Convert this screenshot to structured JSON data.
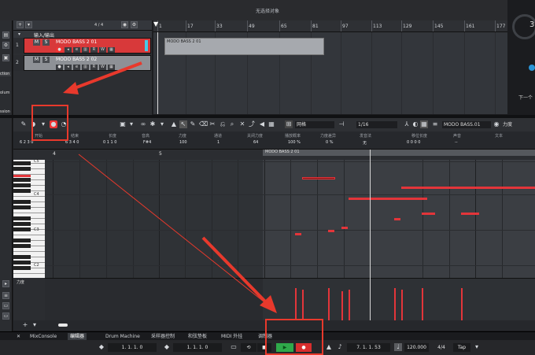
{
  "window": {
    "title": "无选择对象"
  },
  "left_strip": {
    "labels": [
      "ction",
      "olum",
      "ssion"
    ]
  },
  "track_list": {
    "counter": "4 / 4",
    "folder": {
      "label": "输入/输出"
    },
    "tracks": [
      {
        "number": "1",
        "name": "MODO BASS 2 01",
        "mute": "M",
        "solo": "S",
        "read": "R",
        "write": "W"
      },
      {
        "number": "2",
        "name": "MODO BASS 2 02",
        "mute": "M",
        "solo": "S",
        "read": "R",
        "write": "W"
      }
    ]
  },
  "project_ruler": {
    "bars": [
      "1",
      "17",
      "33",
      "49",
      "65",
      "81",
      "97",
      "113",
      "129",
      "145",
      "161",
      "177"
    ]
  },
  "arrange": {
    "part_label": "MODO BASS 2 01"
  },
  "right_panel": {
    "digit": "3",
    "caption": "下一个"
  },
  "editor_toolbar": {
    "grid_type": "网格",
    "quantize": "1/16",
    "instrument": "MODO BASS.01",
    "controller": "力度"
  },
  "info_bar": {
    "fields": [
      {
        "label": "开始",
        "value": "6  2  3  0"
      },
      {
        "label": "结束",
        "value": "6  3  4  0"
      },
      {
        "label": "长度",
        "value": "0  1  1  0"
      },
      {
        "label": "音高",
        "value": "F#4"
      },
      {
        "label": "力度",
        "value": "100"
      },
      {
        "label": "通道",
        "value": "1"
      },
      {
        "label": "关闭力度",
        "value": "64"
      },
      {
        "label": "播放概率",
        "value": "100 %"
      },
      {
        "label": "力度差异",
        "value": "0 %"
      },
      {
        "label": "发音法",
        "value": "无"
      },
      {
        "label": "移位长度",
        "value": "0  0  0  0"
      },
      {
        "label": "声音",
        "value": "--"
      },
      {
        "label": "文本",
        "value": ""
      }
    ]
  },
  "editor_ruler": {
    "bars": [
      "4",
      "5",
      "6",
      "7",
      "8"
    ],
    "part_label": "MODO BASS 2 01"
  },
  "keyboard": {
    "labels": [
      "C5",
      "C4",
      "C3",
      "C2"
    ]
  },
  "velocity": {
    "label": "力度"
  },
  "bottom_tabs": [
    "MixConsole",
    "编辑器",
    "Drum Machine",
    "采样器控制",
    "和弦垫板",
    "MIDI 外挂",
    "调制器"
  ],
  "transport": {
    "left_locator": "1. 1. 1. 0",
    "right_locator": "1. 1. 1. 0",
    "position": "7. 1. 1. 53",
    "tempo": "120.000",
    "signature": "4/4",
    "tap": "Tap"
  },
  "annotation_color": "#e8392c"
}
